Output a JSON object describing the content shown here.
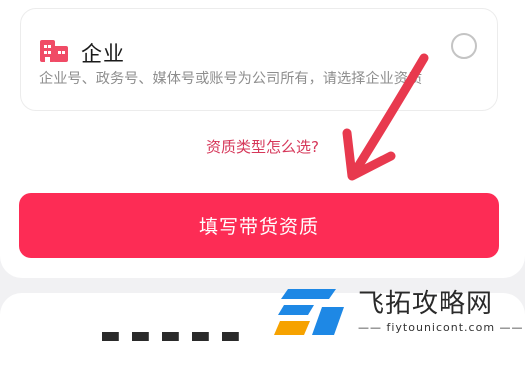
{
  "option": {
    "title": "企业",
    "description": "企业号、政务号、媒体号或账号为公司所有，请选择企业资质",
    "selected": false,
    "icon": "building-icon"
  },
  "help_link": "资质类型怎么选?",
  "primary_button": "填写带货资质",
  "annotation_arrow_color": "#e8394e",
  "watermark": {
    "text": "飞拓攻略网",
    "sub": "—— fiytounicont.com ——"
  }
}
